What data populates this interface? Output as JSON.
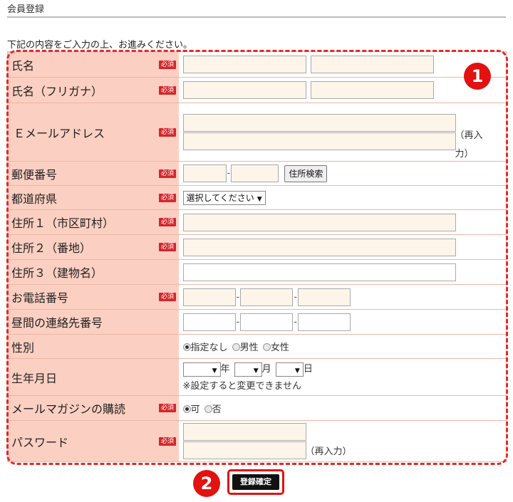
{
  "page": {
    "title": "会員登録",
    "intro": "下記の内容をご入力の上、お進みください。"
  },
  "required_badge": "必須",
  "fields": {
    "name": {
      "label": "氏名"
    },
    "name_kana": {
      "label": "氏名（フリガナ）"
    },
    "email": {
      "label": "Ｅメールアドレス",
      "reenter_note": "（再入力）"
    },
    "postal": {
      "label": "郵便番号",
      "search_button": "住所検索"
    },
    "prefecture": {
      "label": "都道府県",
      "selected": "選択してください"
    },
    "address1": {
      "label": "住所１（市区町村）"
    },
    "address2": {
      "label": "住所２（番地）"
    },
    "address3": {
      "label": "住所３（建物名）"
    },
    "phone": {
      "label": "お電話番号"
    },
    "day_phone": {
      "label": "昼間の連絡先番号"
    },
    "gender": {
      "label": "性別",
      "options": [
        "指定なし",
        "男性",
        "女性"
      ],
      "selected": "指定なし"
    },
    "birthdate": {
      "label": "生年月日",
      "year_unit": "年",
      "month_unit": "月",
      "day_unit": "日",
      "note": "※設定すると変更できません"
    },
    "newsletter": {
      "label": "メールマガジンの購読",
      "options": [
        "可",
        "否"
      ],
      "selected": "可"
    },
    "password": {
      "label": "パスワード",
      "reenter_note": "（再入力）"
    }
  },
  "dash": "-",
  "submit_button": "登録確定",
  "markers": [
    "1",
    "2"
  ],
  "colors": {
    "label_bg": "#fbcfc1",
    "required_bg": "#d3262b",
    "input_bg": "#fdf4ea",
    "highlight": "#e32a2a"
  }
}
